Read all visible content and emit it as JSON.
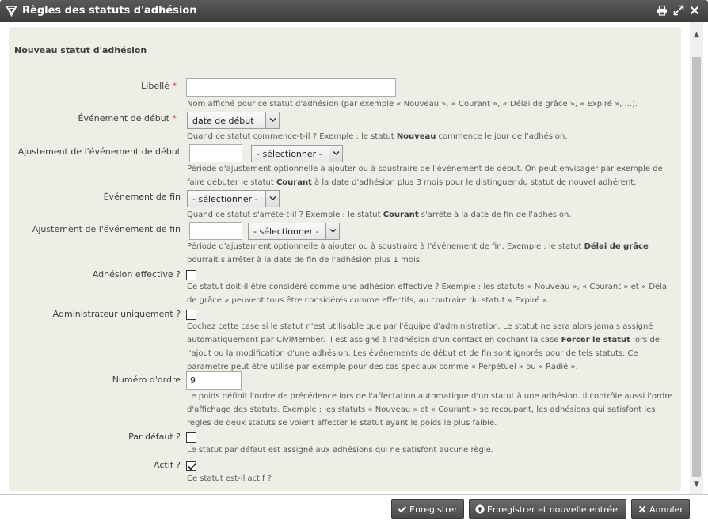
{
  "window": {
    "title": "Règles des statuts d'adhésion"
  },
  "form": {
    "legend": "Nouveau statut d'adhésion",
    "required_marker": "*",
    "libelle": {
      "label": "Libellé",
      "value": "",
      "help": "Nom affiché pour ce statut d'adhésion (par exemple « Nouveau », « Courant », « Délai de grâce », « Expiré », ...)."
    },
    "start_event": {
      "label": "Événement de début",
      "value": "date de début",
      "help_pre": "Quand ce statut commence-t-il ? Exemple : le statut ",
      "help_bold": "Nouveau",
      "help_post": " commence le jour de l'adhésion."
    },
    "start_adjust": {
      "label": "Ajustement de l'événement de début",
      "value": "",
      "unit": "- sélectionner -",
      "help_pre": "Période d'ajustement optionnelle à ajouter ou à soustraire de l'événement de début. On peut envisager par exemple de faire débuter le statut ",
      "help_bold": "Courant",
      "help_post": " à la date d'adhésion plus 3 mois pour le distinguer du statut de nouvel adhérent."
    },
    "end_event": {
      "label": "Événement de fin",
      "value": "- sélectionner -",
      "help_pre": "Quand ce statut s'arrête-t-il ? Exemple : le statut ",
      "help_bold": "Courant",
      "help_post": " s'arrête à la date de fin de l'adhésion."
    },
    "end_adjust": {
      "label": "Ajustement de l'événement de fin",
      "value": "",
      "unit": "- sélectionner -",
      "help_pre": "Période d'ajustement optionnelle à ajouter ou à soustraire à l'événement de fin. Exemple : le statut ",
      "help_bold": "Délai de grâce",
      "help_post": " pourrait s'arrêter à la date de fin de l'adhésion plus 1 mois."
    },
    "is_current": {
      "label": "Adhésion effective ?",
      "checked": false,
      "help": "Ce statut doit-il être considéré comme une adhésion effective ? Exemple : les statuts « Nouveau », « Courant » et « Délai de grâce » peuvent tous être considérés comme effectifs, au contraire du statut « Expiré »."
    },
    "admin_only": {
      "label": "Administrateur uniquement ?",
      "checked": false,
      "help_pre": "Cochez cette case si le statut n'est utilisable que par l'équipe d'administration. Le statut ne sera alors jamais assigné automatiquement par CiviMember. Il est assigné à l'adhésion d'un contact en cochant la case ",
      "help_bold": "Forcer le statut",
      "help_post": " lors de l'ajout ou la modification d'une adhésion. Les événements de début et de fin sont ignorés pour de tels statuts. Ce paramètre peut être utilisé par exemple pour des cas spéciaux comme « Perpétuel » ou « Radié »."
    },
    "weight": {
      "label": "Numéro d'ordre",
      "value": "9",
      "help": "Le poids définit l'ordre de précédence lors de l'affectation automatique d'un statut à une adhésion. Il contrôle aussi l'ordre d'affichage des statuts. Exemple : les statuts « Nouveau » et « Courant » se recoupant, les adhésions qui satisfont les règles de deux statuts se voient affecter le statut ayant le poids le plus faible."
    },
    "is_default": {
      "label": "Par défaut ?",
      "checked": false,
      "help": "Le statut par défaut est assigné aux adhésions qui ne satisfont aucune règle."
    },
    "is_active": {
      "label": "Actif ?",
      "checked": true,
      "help": "Ce statut est-il actif ?"
    }
  },
  "buttons": {
    "save": "Enregistrer",
    "save_new": "Enregistrer et nouvelle entrée",
    "cancel": "Annuler"
  },
  "colors": {
    "titlebar": "#4a4a4a",
    "panel": "#eeeee6",
    "required": "#cf3458",
    "button": "#555555"
  },
  "icons": {
    "window": "triangle-logo-icon",
    "print": "print-icon",
    "maximize": "maximize-icon",
    "close": "close-icon",
    "save": "check-icon",
    "save_new": "plus-circle-icon",
    "cancel": "close-icon"
  }
}
